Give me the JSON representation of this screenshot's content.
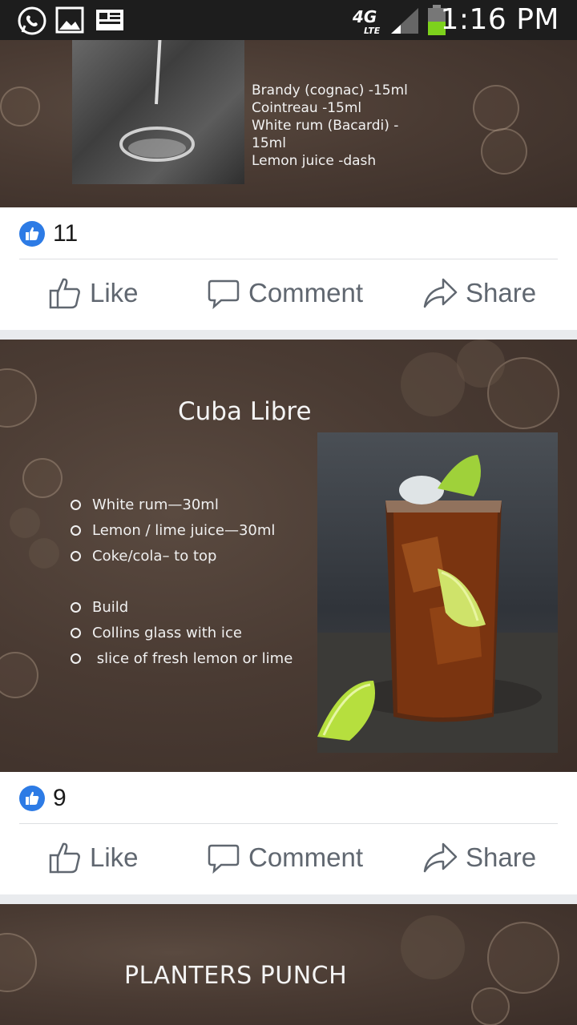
{
  "status_bar": {
    "time": "1:16 PM",
    "network": "4G",
    "network_sub": "LTE",
    "icons": [
      "whatsapp-icon",
      "gallery-icon",
      "news-icon",
      "signal-icon",
      "battery-icon"
    ]
  },
  "post1": {
    "ingredients": [
      "Brandy (cognac) -15ml",
      "Cointreau -15ml",
      "White rum (Bacardi) -",
      "15ml",
      "Lemon juice -dash"
    ],
    "like_count": "11",
    "actions": {
      "like": "Like",
      "comment": "Comment",
      "share": "Share"
    }
  },
  "post2": {
    "title": "Cuba Libre",
    "ingredients": [
      "White rum—30ml",
      "Lemon / lime juice—30ml",
      "Coke/cola– to top"
    ],
    "method": [
      "Build",
      "Collins glass with ice",
      " slice of fresh lemon or lime"
    ],
    "like_count": "9",
    "actions": {
      "like": "Like",
      "comment": "Comment",
      "share": "Share"
    }
  },
  "post3": {
    "title": "PLANTERS PUNCH"
  },
  "colors": {
    "facebook_blue": "#2d7be5",
    "action_gray": "#606770",
    "slide_brown": "#4a3b33"
  }
}
